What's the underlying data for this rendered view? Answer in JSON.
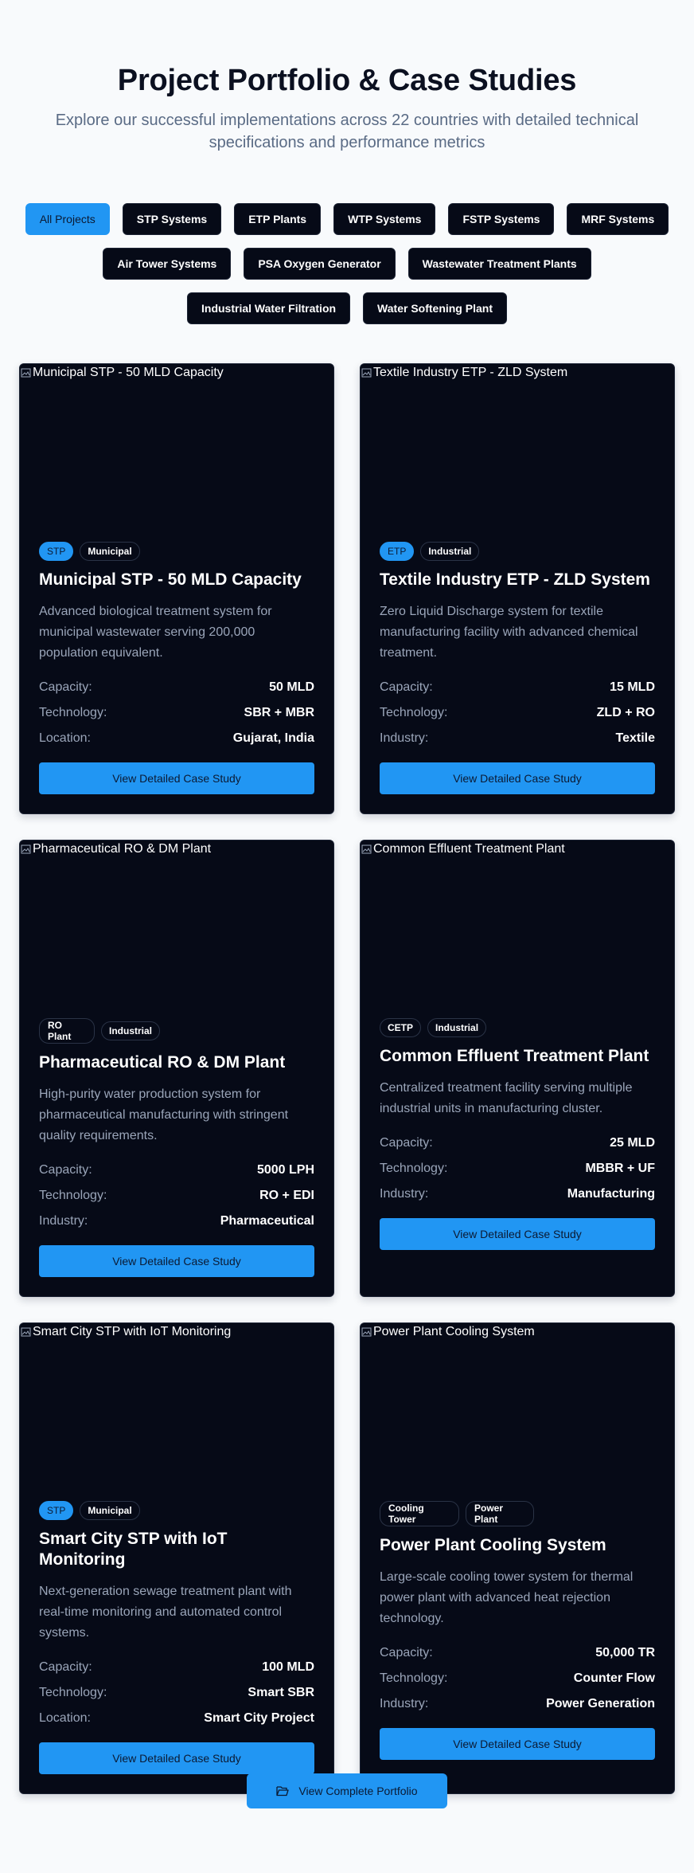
{
  "header": {
    "title": "Project Portfolio & Case Studies",
    "subtitle": "Explore our successful implementations across 22 countries with detailed technical specifications and performance metrics"
  },
  "filters": [
    {
      "label": "All Projects",
      "active": true
    },
    {
      "label": "STP Systems",
      "active": false
    },
    {
      "label": "ETP Plants",
      "active": false
    },
    {
      "label": "WTP Systems",
      "active": false
    },
    {
      "label": "FSTP Systems",
      "active": false
    },
    {
      "label": "MRF Systems",
      "active": false
    },
    {
      "label": "Air Tower Systems",
      "active": false
    },
    {
      "label": "PSA Oxygen Generator",
      "active": false
    },
    {
      "label": "Wastewater Treatment Plants",
      "active": false
    },
    {
      "label": "Industrial Water Filtration",
      "active": false
    },
    {
      "label": "Water Softening Plant",
      "active": false
    }
  ],
  "projects": [
    {
      "image_alt": "Municipal STP - 50 MLD Capacity",
      "tags": [
        "STP",
        "Municipal"
      ],
      "title": "Municipal STP - 50 MLD Capacity",
      "description": "Advanced biological treatment system for municipal wastewater serving 200,000 population equivalent.",
      "specs": [
        {
          "label": "Capacity:",
          "value": "50 MLD"
        },
        {
          "label": "Technology:",
          "value": "SBR + MBR"
        },
        {
          "label": "Location:",
          "value": "Gujarat, India"
        }
      ],
      "button": "View Detailed Case Study"
    },
    {
      "image_alt": "Textile Industry ETP - ZLD System",
      "tags": [
        "ETP",
        "Industrial"
      ],
      "title": "Textile Industry ETP - ZLD System",
      "description": "Zero Liquid Discharge system for textile manufacturing facility with advanced chemical treatment.",
      "specs": [
        {
          "label": "Capacity:",
          "value": "15 MLD"
        },
        {
          "label": "Technology:",
          "value": "ZLD + RO"
        },
        {
          "label": "Industry:",
          "value": "Textile"
        }
      ],
      "button": "View Detailed Case Study"
    },
    {
      "image_alt": "Pharmaceutical RO & DM Plant",
      "tags": [
        "RO Plant",
        "Industrial"
      ],
      "title": "Pharmaceutical RO & DM Plant",
      "description": "High-purity water production system for pharmaceutical manufacturing with stringent quality requirements.",
      "specs": [
        {
          "label": "Capacity:",
          "value": "5000 LPH"
        },
        {
          "label": "Technology:",
          "value": "RO + EDI"
        },
        {
          "label": "Industry:",
          "value": "Pharmaceutical"
        }
      ],
      "button": "View Detailed Case Study"
    },
    {
      "image_alt": "Common Effluent Treatment Plant",
      "tags": [
        "CETP",
        "Industrial"
      ],
      "title": "Common Effluent Treatment Plant",
      "description": "Centralized treatment facility serving multiple industrial units in manufacturing cluster.",
      "specs": [
        {
          "label": "Capacity:",
          "value": "25 MLD"
        },
        {
          "label": "Technology:",
          "value": "MBBR + UF"
        },
        {
          "label": "Industry:",
          "value": "Manufacturing"
        }
      ],
      "button": "View Detailed Case Study"
    },
    {
      "image_alt": "Smart City STP with IoT Monitoring",
      "tags": [
        "STP",
        "Municipal"
      ],
      "title": "Smart City STP with IoT Monitoring",
      "description": "Next-generation sewage treatment plant with real-time monitoring and automated control systems.",
      "specs": [
        {
          "label": "Capacity:",
          "value": "100 MLD"
        },
        {
          "label": "Technology:",
          "value": "Smart SBR"
        },
        {
          "label": "Location:",
          "value": "Smart City Project"
        }
      ],
      "button": "View Detailed Case Study"
    },
    {
      "image_alt": "Power Plant Cooling System",
      "tags": [
        "Cooling Tower",
        "Power Plant"
      ],
      "title": "Power Plant Cooling System",
      "description": "Large-scale cooling tower system for thermal power plant with advanced heat rejection technology.",
      "specs": [
        {
          "label": "Capacity:",
          "value": "50,000 TR"
        },
        {
          "label": "Technology:",
          "value": "Counter Flow"
        },
        {
          "label": "Industry:",
          "value": "Power Generation"
        }
      ],
      "button": "View Detailed Case Study"
    }
  ],
  "footer": {
    "portfolio_button": "View Complete Portfolio",
    "portfolio_icon": "folder-open-icon"
  },
  "colors": {
    "accent": "#2196f3",
    "card_bg": "#060a17",
    "page_bg": "#f8fafc"
  }
}
